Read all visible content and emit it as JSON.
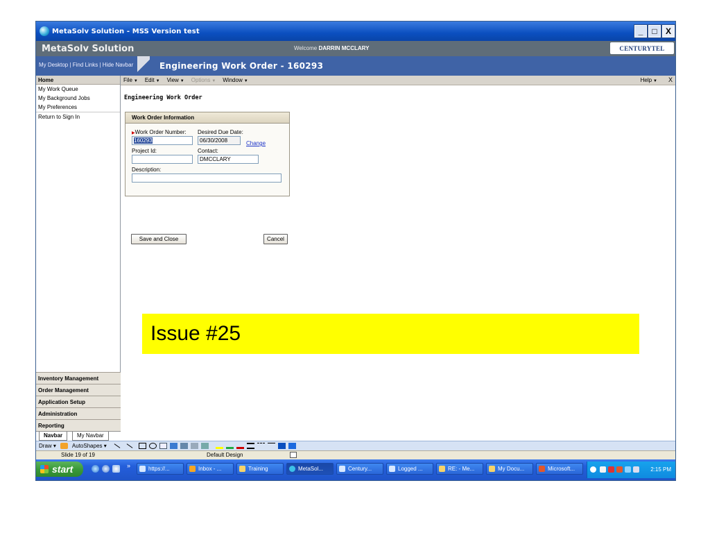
{
  "window": {
    "title": "MetaSolv Solution - MSS Version test",
    "minimize": "_",
    "maximize": "□",
    "close": "X"
  },
  "header": {
    "brand": "MetaSolv Solution",
    "welcome_prefix": "Welcome",
    "user": "DARRIN MCCLARY",
    "logo": "CENTURYTEL"
  },
  "navline": {
    "links": [
      "My Desktop",
      "Find Links",
      "Hide Navbar"
    ],
    "separator": " | ",
    "page_heading": "Engineering Work Order  - 160293"
  },
  "sidebar": {
    "home": "Home",
    "items": [
      "My Work Queue",
      "My Background Jobs",
      "My Preferences",
      "Return to Sign In"
    ],
    "sections": [
      "Inventory Management",
      "Order Management",
      "Application Setup",
      "Administration",
      "Reporting"
    ],
    "tabs": [
      "Navbar",
      "My Navbar"
    ]
  },
  "menubar": {
    "items": [
      {
        "label": "File",
        "disabled": false
      },
      {
        "label": "Edit",
        "disabled": false
      },
      {
        "label": "View",
        "disabled": false
      },
      {
        "label": "Options",
        "disabled": true
      },
      {
        "label": "Window",
        "disabled": false
      }
    ],
    "help": "Help",
    "close": "X"
  },
  "form": {
    "title": "Engineering Work Order",
    "panel_title": "Work Order Information",
    "work_order_label": "Work Order Number:",
    "work_order_value": "160293",
    "due_date_label": "Desired Due Date:",
    "due_date_value": "06/30/2008",
    "change_link": "Change",
    "project_label": "Project Id:",
    "project_value": "",
    "contact_label": "Contact:",
    "contact_value": "DMCCLARY",
    "description_label": "Description:",
    "description_value": "",
    "save_button": "Save and Close",
    "cancel_button": "Cancel"
  },
  "overlay": {
    "issue": "Issue #25"
  },
  "drawbar": {
    "draw": "Draw",
    "autoshapes": "AutoShapes"
  },
  "statusbar": {
    "slide": "Slide 19 of 19",
    "design": "Default Design"
  },
  "taskbar": {
    "start": "start",
    "tasks": [
      {
        "label": "https://...",
        "color": "#d8e8ff"
      },
      {
        "label": "Inbox - ...",
        "color": "#f5a623"
      },
      {
        "label": "Training",
        "color": "#f6d36b"
      },
      {
        "label": "MetaSol...",
        "color": "#3cc0e8"
      },
      {
        "label": "Century...",
        "color": "#d8e8ff"
      },
      {
        "label": "Logged ...",
        "color": "#d8e8ff"
      },
      {
        "label": "RE: - Me...",
        "color": "#f6d36b"
      },
      {
        "label": "My Docu...",
        "color": "#f6d36b"
      },
      {
        "label": "Microsoft...",
        "color": "#e2572b"
      }
    ],
    "clock": "2:15 PM"
  }
}
